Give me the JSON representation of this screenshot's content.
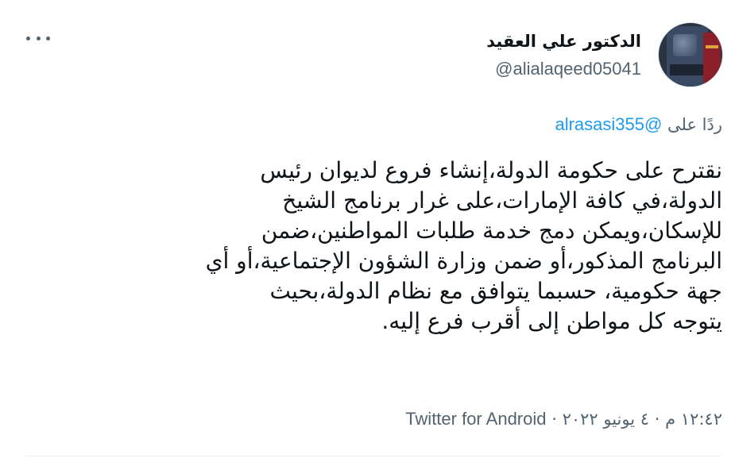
{
  "author": {
    "display_name": "الدكتور علي العقيد",
    "handle": "@alialaqeed05041"
  },
  "reply": {
    "prefix": "ردًا على",
    "mention": "@alrasasi355"
  },
  "tweet": {
    "lines": [
      "نقترح على حكومة الدولة،إنشاء فروع لديوان رئيس",
      "الدولة،في كافة الإمارات،على غرار برنامج الشيخ",
      "للإسكان،ويمكن دمج خدمة طلبات المواطنين،ضمن",
      "البرنامج المذكور،أو ضمن وزارة الشؤون الإجتماعية،أو أي",
      "جهة حكومية، حسبما يتوافق مع نظام الدولة،بحيث",
      "يتوجه كل مواطن إلى أقرب فرع إليه."
    ]
  },
  "meta": {
    "time": "١٢:٤٢ م",
    "date": "٤ يونيو ٢٠٢٢",
    "separator": "·",
    "source": "Twitter for Android"
  },
  "icons": {
    "more": "more-horizontal-icon",
    "avatar": "profile-avatar"
  },
  "colors": {
    "text": "#0f1419",
    "secondary": "#536471",
    "link": "#1d9bf0",
    "divider": "#eff3f4"
  }
}
